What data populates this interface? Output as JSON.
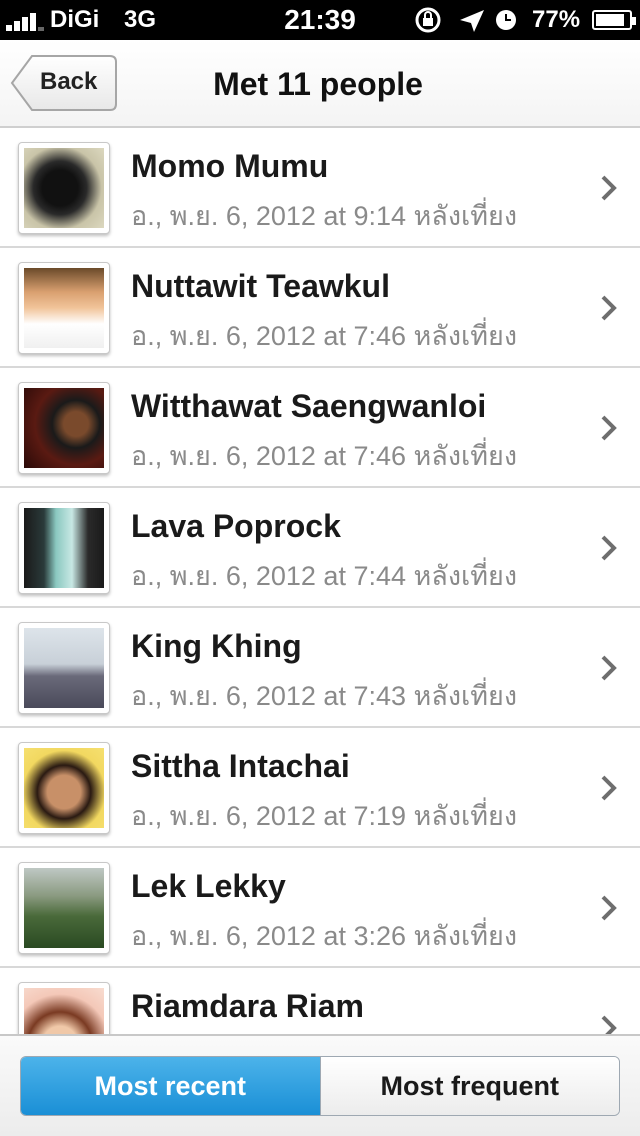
{
  "status_bar": {
    "carrier": "DiGi",
    "network": "3G",
    "time": "21:39",
    "battery": "77%",
    "battery_level": 0.77
  },
  "nav": {
    "back_label": "Back",
    "title": "Met 11 people"
  },
  "people": [
    {
      "name": "Momo Mumu",
      "date": "อ., พ.ย. 6, 2012 at 9:14 หลังเที่ยง"
    },
    {
      "name": "Nuttawit Teawkul",
      "date": "อ., พ.ย. 6, 2012 at 7:46 หลังเที่ยง"
    },
    {
      "name": "Witthawat Saengwanloi",
      "date": "อ., พ.ย. 6, 2012 at 7:46 หลังเที่ยง"
    },
    {
      "name": "Lava Poprock",
      "date": "อ., พ.ย. 6, 2012 at 7:44 หลังเที่ยง"
    },
    {
      "name": "King Khing",
      "date": "อ., พ.ย. 6, 2012 at 7:43 หลังเที่ยง"
    },
    {
      "name": "Sittha Intachai",
      "date": "อ., พ.ย. 6, 2012 at 7:19 หลังเที่ยง"
    },
    {
      "name": "Lek Lekky",
      "date": "อ., พ.ย. 6, 2012 at 3:26 หลังเที่ยง"
    },
    {
      "name": "Riamdara Riam",
      "date": ""
    }
  ],
  "segmented": {
    "most_recent": "Most recent",
    "most_frequent": "Most frequent"
  },
  "colors": {
    "accent_blue": "#1a8fd6",
    "date_gray": "#8a8a8a"
  }
}
